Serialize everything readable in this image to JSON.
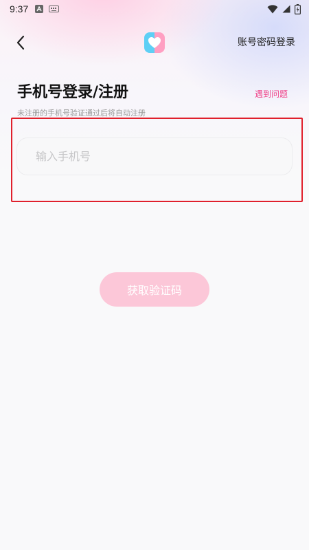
{
  "status_bar": {
    "time": "9:37"
  },
  "header": {
    "back_icon": "chevron-left-icon",
    "logo_icon": "heart-icon",
    "account_login_label": "账号密码登录"
  },
  "login": {
    "title": "手机号登录/注册",
    "help_label": "遇到问题",
    "subtitle": "未注册的手机号验证通过后将自动注册",
    "phone_value": "",
    "phone_placeholder": "输入手机号",
    "get_code_label": "获取验证码"
  },
  "colors": {
    "accent_pink": "#f0448a",
    "button_pink": "#fcc7d8",
    "highlight_red": "#e0202c",
    "logo_blue": "#5ecff5",
    "logo_pink": "#ff9fc2"
  }
}
